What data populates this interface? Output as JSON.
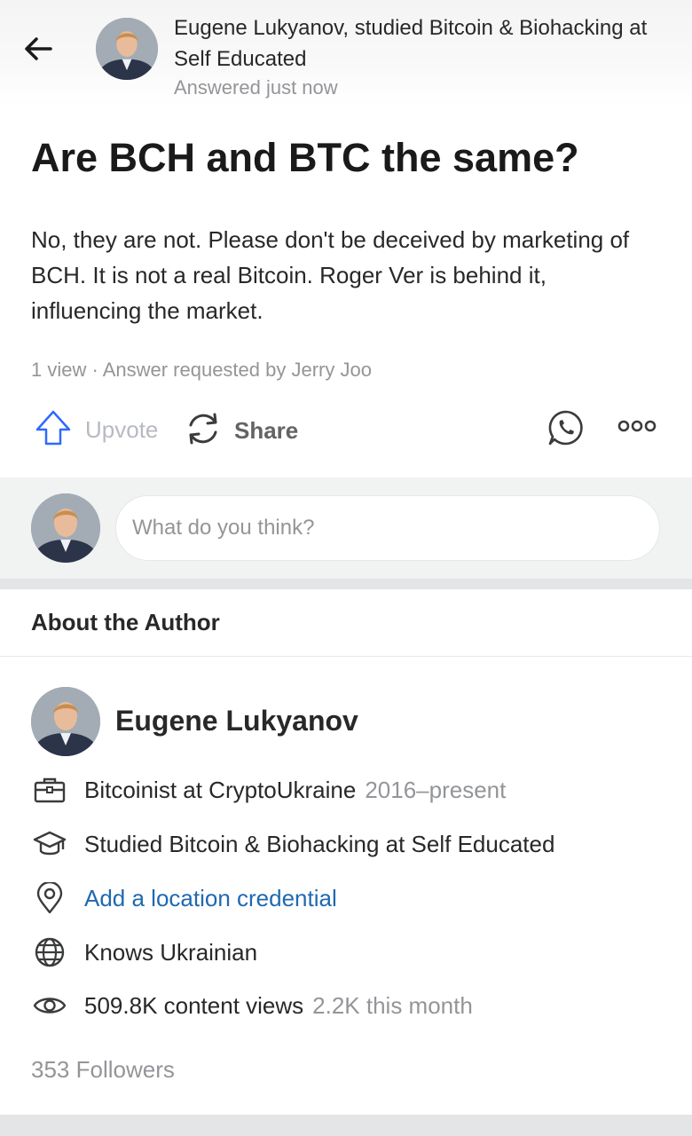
{
  "header": {
    "author_line": "Eugene Lukyanov, studied Bitcoin & Biohacking at Self Educated",
    "timestamp": "Answered just now"
  },
  "question": {
    "title": "Are BCH and BTC the same?"
  },
  "answer": {
    "text": "No, they are not. Please don't be deceived by marketing of BCH. It is not a real Bitcoin. Roger Ver is behind it, influencing the market.",
    "meta": "1 view · Answer requested by Jerry Joo"
  },
  "actions": {
    "upvote_label": "Upvote",
    "share_label": "Share",
    "icons": [
      "arrow-up-outline-icon",
      "refresh-share-icon",
      "whatsapp-icon",
      "more-dots-icon"
    ]
  },
  "comment": {
    "placeholder": "What do you think?"
  },
  "about": {
    "title": "About the Author",
    "name": "Eugene Lukyanov",
    "credentials": [
      {
        "icon": "briefcase-icon",
        "text": "Bitcoinist at CryptoUkraine",
        "sub": "2016–present"
      },
      {
        "icon": "graduation-cap-icon",
        "text": "Studied Bitcoin & Biohacking at Self Educated",
        "sub": ""
      },
      {
        "icon": "location-pin-icon",
        "text": "Add a location credential",
        "sub": ""
      },
      {
        "icon": "globe-icon",
        "text": "Knows Ukrainian",
        "sub": ""
      },
      {
        "icon": "eye-icon",
        "text": "509.8K content views",
        "sub": "2.2K this month"
      }
    ],
    "followers": "353 Followers"
  },
  "colors": {
    "link": "#1f69b0",
    "muted": "#939598",
    "upvote_icon": "#2e69ff",
    "text": "#282829"
  }
}
